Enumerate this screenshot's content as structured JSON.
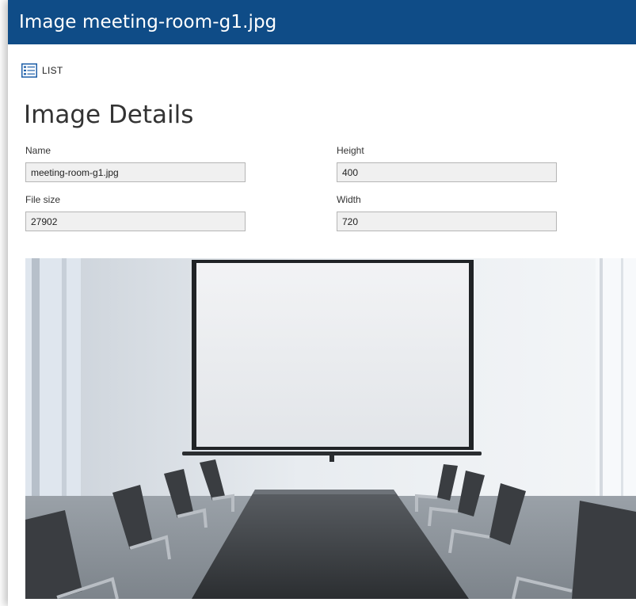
{
  "window": {
    "title": "Image meeting-room-g1.jpg"
  },
  "toolbar": {
    "list_label": "LIST",
    "list_icon": "list-icon"
  },
  "page": {
    "heading": "Image Details"
  },
  "fields": {
    "name": {
      "label": "Name",
      "value": "meeting-room-g1.jpg"
    },
    "height": {
      "label": "Height",
      "value": "400"
    },
    "size": {
      "label": "File size",
      "value": "27902"
    },
    "width": {
      "label": "Width",
      "value": "720"
    }
  },
  "colors": {
    "titlebar": "#0f4c87",
    "icon_blue": "#1e5fa8",
    "input_bg": "#f0f0f0"
  }
}
